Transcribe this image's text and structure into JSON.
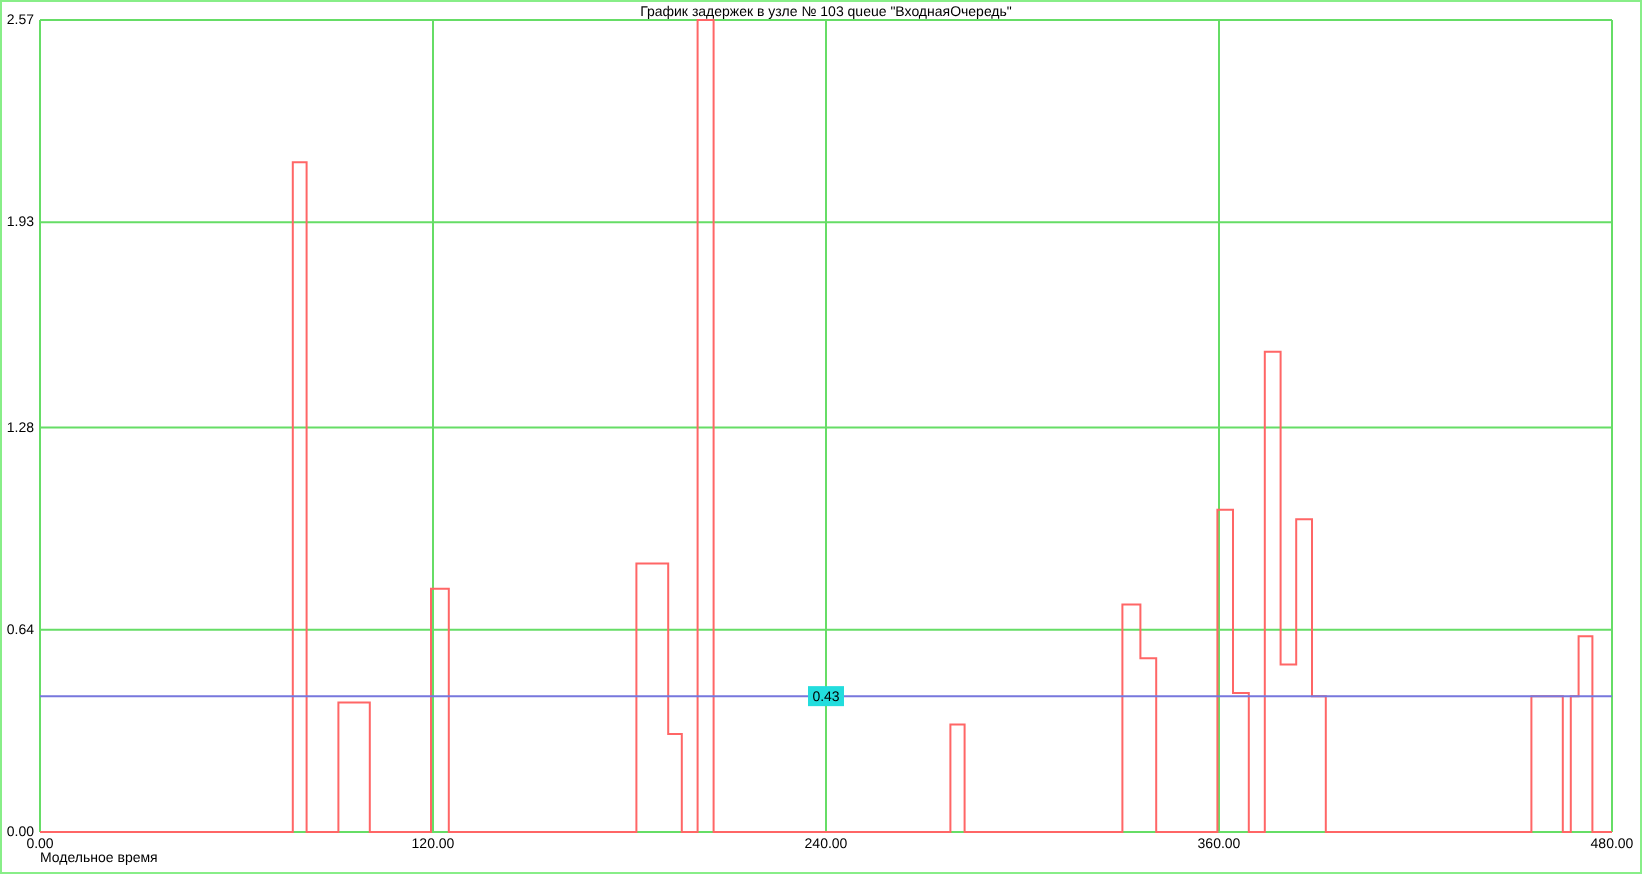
{
  "chart_data": {
    "type": "line",
    "title": "График задержек в узле № 103 queue \"ВходнаяОчередь\"",
    "xlabel": "Модельное время",
    "xlim": [
      0,
      480
    ],
    "ylim": [
      0,
      2.57
    ],
    "xticks": [
      {
        "value": 0,
        "label": "0.00"
      },
      {
        "value": 120,
        "label": "120.00"
      },
      {
        "value": 240,
        "label": "240.00"
      },
      {
        "value": 360,
        "label": "360.00"
      },
      {
        "value": 480,
        "label": "480.00"
      }
    ],
    "yticks": [
      {
        "value": 0,
        "label": "0.00"
      },
      {
        "value": 0.64,
        "label": "0.64"
      },
      {
        "value": 1.28,
        "label": "1.28"
      },
      {
        "value": 1.93,
        "label": "1.93"
      },
      {
        "value": 2.57,
        "label": "2.57"
      }
    ],
    "x": [
      0,
      77.2,
      77.2,
      81.4,
      81.4,
      91.1,
      91.1,
      100.7,
      100.7,
      119.4,
      119.4,
      124.8,
      124.8,
      182.1,
      182.1,
      191.8,
      191.8,
      196,
      196,
      200.8,
      200.8,
      205.7,
      205.7,
      278,
      278,
      282.3,
      282.3,
      330.5,
      330.5,
      336,
      336,
      340.8,
      340.8,
      359.5,
      359.5,
      364.3,
      364.3,
      369.1,
      369.1,
      374,
      374,
      378.8,
      378.8,
      383.6,
      383.6,
      388.4,
      388.4,
      392.6,
      392.6,
      455.4,
      455.4,
      465,
      465,
      467.4,
      467.4,
      469.8,
      469.8,
      474,
      474,
      480
    ],
    "series": [
      {
        "color": "#ff6666",
        "values": [
          0,
          0,
          2.12,
          2.12,
          0,
          0,
          0.41,
          0.41,
          0,
          0,
          0.77,
          0.77,
          0,
          0,
          0.85,
          0.85,
          0.31,
          0.31,
          0,
          0,
          2.57,
          2.57,
          0,
          0,
          0.34,
          0.34,
          0,
          0,
          0.72,
          0.72,
          0.55,
          0.55,
          0,
          0,
          1.02,
          1.02,
          0.44,
          0.44,
          0,
          0,
          1.52,
          1.52,
          0.53,
          0.53,
          0.99,
          0.99,
          0.43,
          0.43,
          0,
          0,
          0.43,
          0.43,
          0,
          0,
          0.43,
          0.43,
          0.62,
          0.62,
          0,
          0
        ]
      },
      {
        "color": "#7777dd",
        "values": [
          0.43,
          0.43,
          0.43,
          0.43,
          0.43,
          0.43,
          0.43,
          0.43,
          0.43,
          0.43,
          0.43,
          0.43,
          0.43,
          0.43,
          0.43,
          0.43,
          0.43,
          0.43,
          0.43,
          0.43,
          0.43,
          0.43,
          0.43,
          0.43,
          0.43,
          0.43,
          0.43,
          0.43,
          0.43,
          0.43,
          0.43,
          0.43,
          0.43,
          0.43,
          0.43,
          0.43,
          0.43,
          0.43,
          0.43,
          0.43,
          0.43,
          0.43,
          0.43,
          0.43,
          0.43,
          0.43,
          0.43,
          0.43,
          0.43,
          0.43,
          0.43,
          0.43,
          0.43,
          0.43,
          0.43,
          0.43,
          0.43,
          0.43,
          0.43,
          0.43
        ]
      }
    ],
    "grid": true,
    "annotations": [
      {
        "text": "0.43",
        "x": 240,
        "y": 0.43
      }
    ]
  }
}
